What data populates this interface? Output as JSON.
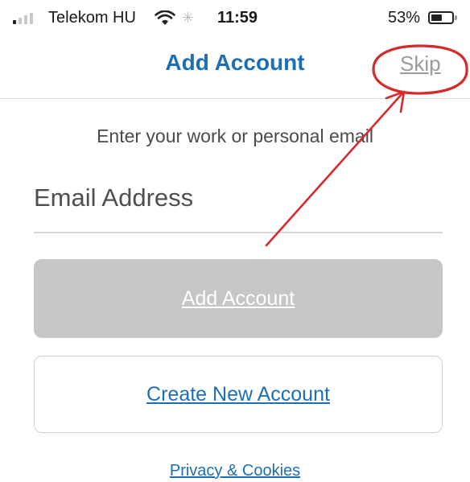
{
  "status_bar": {
    "carrier": "Telekom HU",
    "time": "11:59",
    "battery_percent_label": "53%",
    "battery_level": 0.53,
    "icons": [
      "signal-icon",
      "wifi-icon",
      "activity-spinner-icon",
      "battery-icon"
    ]
  },
  "nav": {
    "title": "Add Account",
    "skip_label": "Skip"
  },
  "form": {
    "subtitle": "Enter your work or personal email",
    "email_placeholder": "Email Address",
    "email_value": ""
  },
  "buttons": {
    "add_account_label": "Add Account",
    "create_account_label": "Create New Account"
  },
  "footer": {
    "privacy_label": "Privacy & Cookies"
  },
  "colors": {
    "accent": "#1d6fb5",
    "disabled_button": "#c6c6c6",
    "annotation": "#d42a2a"
  }
}
